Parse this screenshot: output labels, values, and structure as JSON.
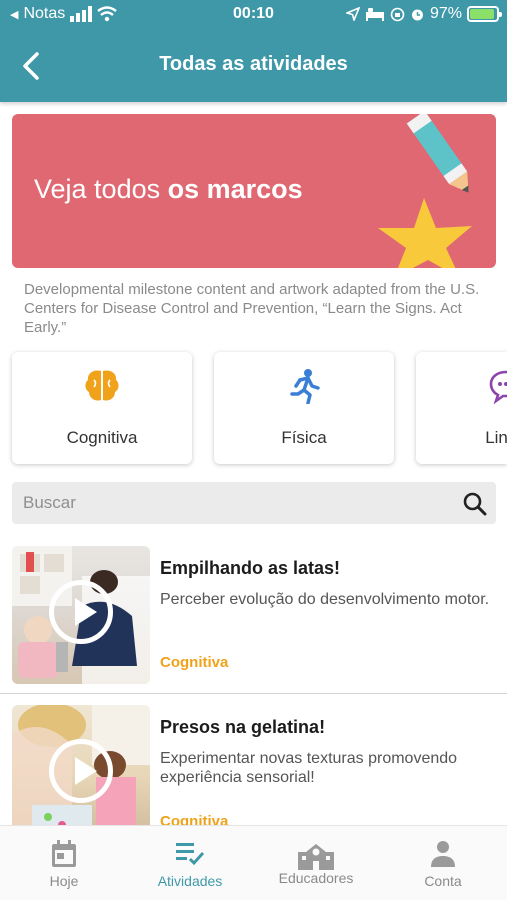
{
  "status_bar": {
    "back_app": "Notas",
    "time": "00:10",
    "battery": "97%"
  },
  "header": {
    "title": "Todas as atividades"
  },
  "banner": {
    "text_light": "Veja todos ",
    "text_bold": "os marcos"
  },
  "credit": "Developmental milestone content and artwork adapted from the U.S. Centers for Disease Control and Prevention, “Learn the Signs. Act Early.”",
  "categories": [
    {
      "label": "Cognitiva",
      "icon": "brain-icon",
      "color": "#f0a21b"
    },
    {
      "label": "Física",
      "icon": "running-person-icon",
      "color": "#3a7fd5"
    },
    {
      "label": "Lingu",
      "icon": "speech-bubble-icon",
      "color": "#8e44ad"
    }
  ],
  "search": {
    "placeholder": "Buscar",
    "value": ""
  },
  "activities": [
    {
      "title": "Empilhando as latas!",
      "description": "Perceber evolução do desenvolvimento motor.",
      "category": "Cognitiva"
    },
    {
      "title": "Presos na gelatina!",
      "description": "Experimentar novas texturas promovendo experiência sensorial!",
      "category": "Cognitiva"
    }
  ],
  "tabbar": [
    {
      "label": "Hoje",
      "icon": "calendar-icon",
      "active": false
    },
    {
      "label": "Atividades",
      "icon": "checklist-icon",
      "active": true
    },
    {
      "label": "Educadores",
      "icon": "school-building-icon",
      "active": false
    },
    {
      "label": "Conta",
      "icon": "person-icon",
      "active": false
    }
  ],
  "colors": {
    "header": "#3f98a8",
    "banner": "#e06872",
    "accent_category": "#f0a21b"
  }
}
